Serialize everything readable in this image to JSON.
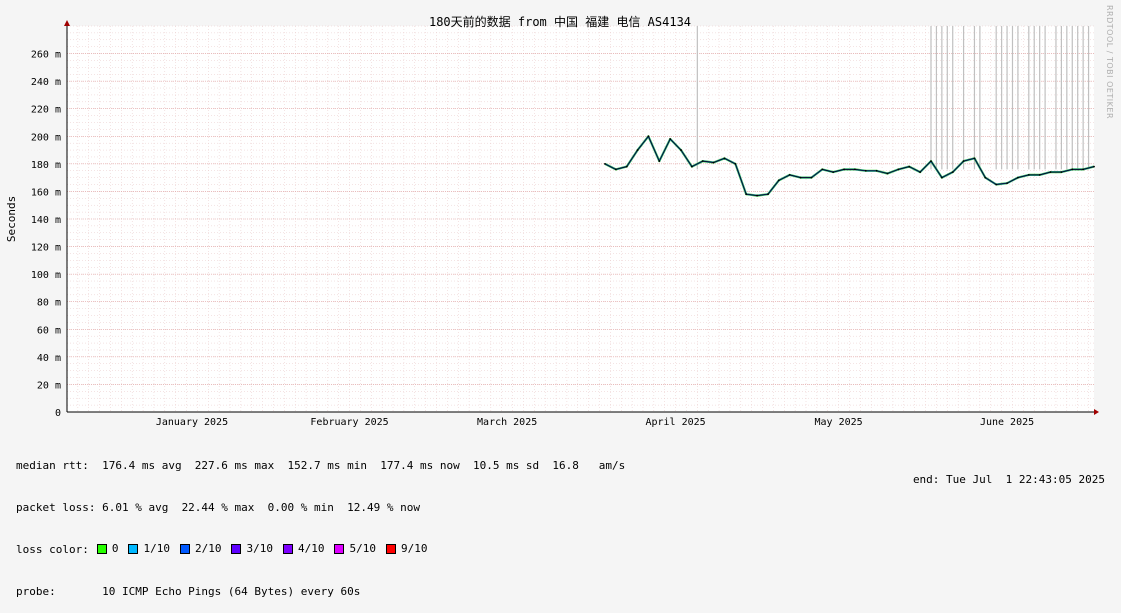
{
  "chart_data": {
    "type": "line",
    "title": "180天前的数据 from 中国 福建 电信 AS4134",
    "ylabel": "Seconds",
    "y_unit_suffix": " m",
    "ylim": [
      0,
      280
    ],
    "y_ticks": [
      0,
      20,
      40,
      60,
      80,
      100,
      120,
      140,
      160,
      180,
      200,
      220,
      240,
      260
    ],
    "x_range": [
      "2024-12-24",
      "2025-07-01"
    ],
    "x_ticks": [
      {
        "label": "January 2025",
        "date": "2025-01-16"
      },
      {
        "label": "February 2025",
        "date": "2025-02-14"
      },
      {
        "label": "March 2025",
        "date": "2025-03-15"
      },
      {
        "label": "April 2025",
        "date": "2025-04-15"
      },
      {
        "label": "May 2025",
        "date": "2025-05-15"
      },
      {
        "label": "June 2025",
        "date": "2025-06-15"
      }
    ],
    "grid": true,
    "series": [
      {
        "x": [
          "2025-04-02",
          "2025-04-04",
          "2025-04-06",
          "2025-04-08",
          "2025-04-10",
          "2025-04-12",
          "2025-04-14",
          "2025-04-16",
          "2025-04-18",
          "2025-04-20",
          "2025-04-22",
          "2025-04-24",
          "2025-04-26",
          "2025-04-28",
          "2025-04-30",
          "2025-05-02",
          "2025-05-04",
          "2025-05-06",
          "2025-05-08",
          "2025-05-10",
          "2025-05-12",
          "2025-05-14",
          "2025-05-16",
          "2025-05-18",
          "2025-05-20",
          "2025-05-22",
          "2025-05-24",
          "2025-05-26",
          "2025-05-28",
          "2025-05-30",
          "2025-06-01",
          "2025-06-03",
          "2025-06-05",
          "2025-06-07",
          "2025-06-09",
          "2025-06-11",
          "2025-06-13",
          "2025-06-15",
          "2025-06-17",
          "2025-06-19",
          "2025-06-21",
          "2025-06-23",
          "2025-06-25",
          "2025-06-27",
          "2025-06-29",
          "2025-07-01"
        ],
        "values": [
          180,
          176,
          178,
          190,
          200,
          182,
          198,
          190,
          178,
          182,
          181,
          184,
          180,
          158,
          157,
          158,
          168,
          172,
          170,
          170,
          176,
          174,
          176,
          176,
          175,
          175,
          173,
          176,
          178,
          174,
          182,
          170,
          174,
          182,
          184,
          170,
          165,
          166,
          170,
          172,
          172,
          174,
          174,
          176,
          176,
          178
        ]
      }
    ]
  },
  "loss_spike_dates": [
    "2025-04-19",
    "2025-06-01",
    "2025-06-02",
    "2025-06-03",
    "2025-06-04",
    "2025-06-05",
    "2025-06-07",
    "2025-06-09",
    "2025-06-10",
    "2025-06-13",
    "2025-06-14",
    "2025-06-15",
    "2025-06-16",
    "2025-06-17",
    "2025-06-19",
    "2025-06-20",
    "2025-06-21",
    "2025-06-22",
    "2025-06-24",
    "2025-06-25",
    "2025-06-26",
    "2025-06-27",
    "2025-06-28",
    "2025-06-29",
    "2025-06-30"
  ],
  "stats": {
    "median_rtt": "median rtt:  176.4 ms avg  227.6 ms max  152.7 ms min  177.4 ms now  10.5 ms sd  16.8   am/s",
    "packet_loss": "packet loss: 6.01 % avg  22.44 % max  0.00 % min  12.49 % now",
    "loss_color_label": "loss color:",
    "loss_colors": [
      {
        "label": "0",
        "color": "#26ff00"
      },
      {
        "label": "1/10",
        "color": "#00b8ff"
      },
      {
        "label": "2/10",
        "color": "#0059ff"
      },
      {
        "label": "3/10",
        "color": "#5e00ff"
      },
      {
        "label": "4/10",
        "color": "#7e00ff"
      },
      {
        "label": "5/10",
        "color": "#dd00ff"
      },
      {
        "label": "9/10",
        "color": "#ff0000"
      }
    ],
    "probe": "probe:       10 ICMP Echo Pings (64 Bytes) every 60s",
    "end": "end: Tue Jul  1 22:43:05 2025"
  },
  "watermark": "RRDTOOL / TOBI OETIKER"
}
